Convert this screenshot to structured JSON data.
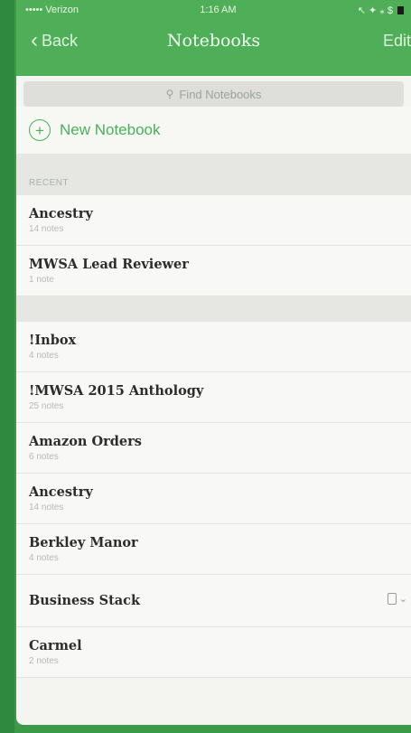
{
  "status": {
    "carrier": "••••• Verizon",
    "wifi": "wifi-icon",
    "time": "1:16 AM",
    "indicators": "↖ ✦ ⁎ $"
  },
  "nav": {
    "back_label": "Back",
    "title": "Notebooks",
    "edit_label": "Edit"
  },
  "search": {
    "placeholder": "Find Notebooks"
  },
  "new_notebook": {
    "label": "New Notebook"
  },
  "recent": {
    "header": "RECENT",
    "items": [
      {
        "name": "Ancestry",
        "count": "14 notes"
      },
      {
        "name": "MWSA Lead Reviewer",
        "count": "1 note"
      }
    ]
  },
  "notebooks": [
    {
      "name": "!Inbox",
      "count": "4 notes"
    },
    {
      "name": "!MWSA 2015 Anthology",
      "count": "25 notes"
    },
    {
      "name": "Amazon Orders",
      "count": "6 notes"
    },
    {
      "name": "Ancestry",
      "count": "14 notes"
    },
    {
      "name": "Berkley Manor",
      "count": "4 notes"
    },
    {
      "name": "Business Stack",
      "count": ""
    },
    {
      "name": "Carmel",
      "count": "2 notes"
    }
  ],
  "colors": {
    "brand_green": "#4fae58",
    "accent_green": "#49b15a"
  }
}
